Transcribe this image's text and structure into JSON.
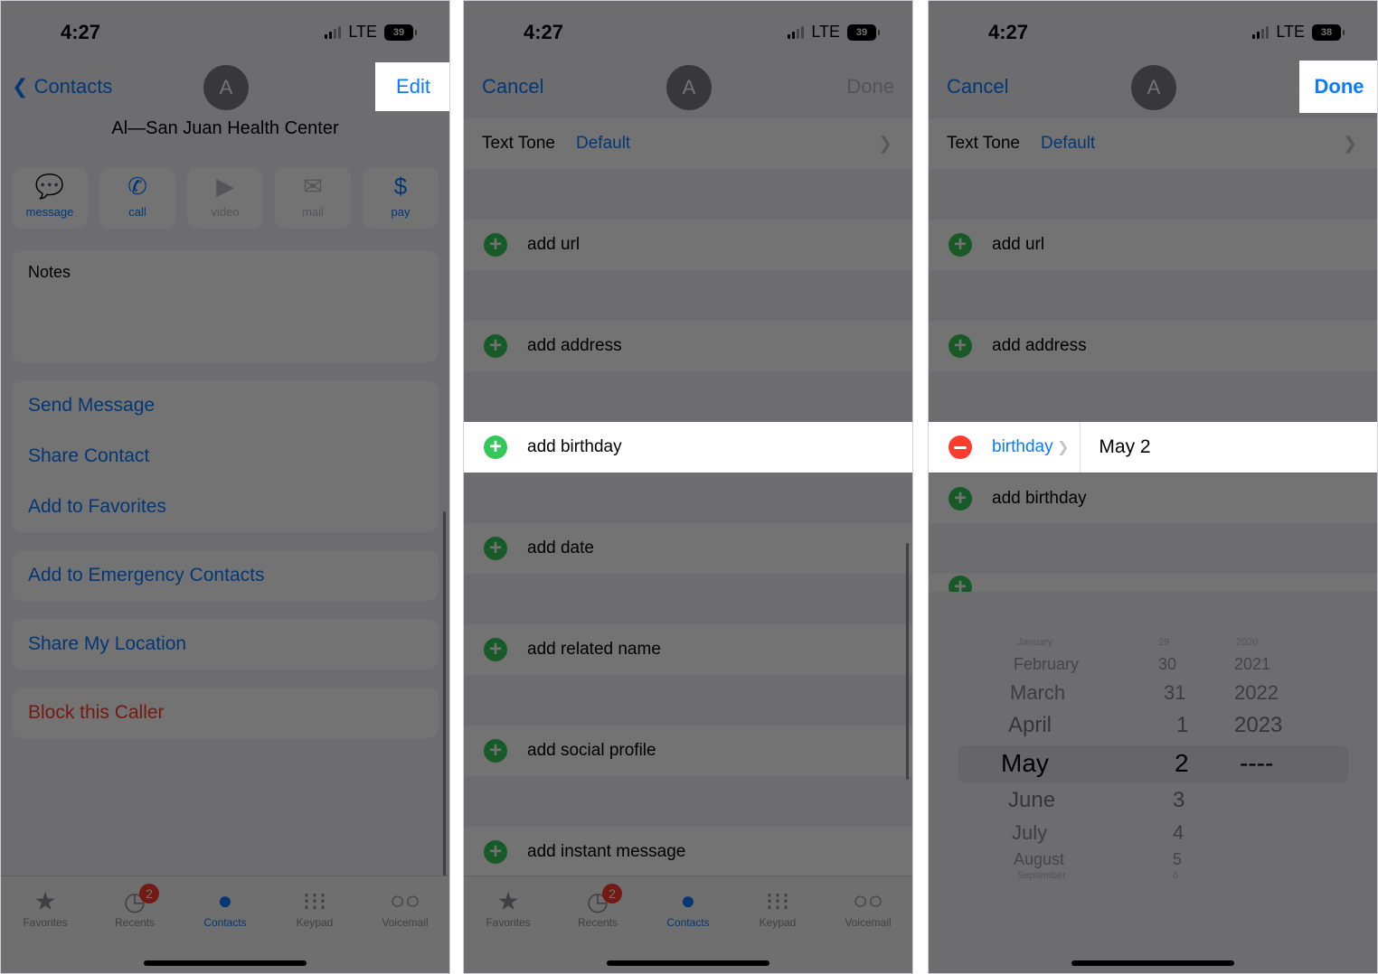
{
  "status": {
    "time": "4:27",
    "network": "LTE"
  },
  "panel1": {
    "battery": "39",
    "back_label": "Contacts",
    "edit_label": "Edit",
    "avatar": "A",
    "contact_name": "Al—San Juan Health Center",
    "actions": [
      {
        "label": "message",
        "icon": "message-icon"
      },
      {
        "label": "call",
        "icon": "phone-icon"
      },
      {
        "label": "video",
        "icon": "video-icon"
      },
      {
        "label": "mail",
        "icon": "mail-icon"
      },
      {
        "label": "pay",
        "icon": "dollar-icon"
      }
    ],
    "notes_label": "Notes",
    "links": [
      "Send Message",
      "Share Contact",
      "Add to Favorites"
    ],
    "emergency": "Add to Emergency Contacts",
    "share_location": "Share My Location",
    "block": "Block this Caller"
  },
  "tabbar": {
    "tabs": [
      "Favorites",
      "Recents",
      "Contacts",
      "Keypad",
      "Voicemail"
    ],
    "recents_badge": "2"
  },
  "panel2": {
    "battery": "39",
    "cancel": "Cancel",
    "done": "Done",
    "avatar": "A",
    "text_tone_label": "Text Tone",
    "text_tone_value": "Default",
    "rows": [
      "add url",
      "add address",
      "add birthday",
      "add date",
      "add related name",
      "add social profile",
      "add instant message"
    ]
  },
  "panel3": {
    "battery": "38",
    "cancel": "Cancel",
    "done": "Done",
    "avatar": "A",
    "text_tone_label": "Text Tone",
    "text_tone_value": "Default",
    "rows": [
      "add url",
      "add address"
    ],
    "birthday_label": "birthday",
    "birthday_value": "May 2",
    "add_birthday": "add birthday",
    "picker": {
      "months": [
        "January",
        "February",
        "March",
        "April",
        "May",
        "June",
        "July",
        "August",
        "September"
      ],
      "days": [
        "29",
        "30",
        "31",
        "1",
        "2",
        "3",
        "4",
        "5",
        "6"
      ],
      "years": [
        "2020",
        "2021",
        "2022",
        "2023",
        "----",
        "",
        "",
        "",
        ""
      ],
      "selected_index": 4
    }
  },
  "colors": {
    "accent": "#0a7aff",
    "add": "#34c759",
    "delete": "#ff3b30",
    "background": "#f2f2f7"
  }
}
